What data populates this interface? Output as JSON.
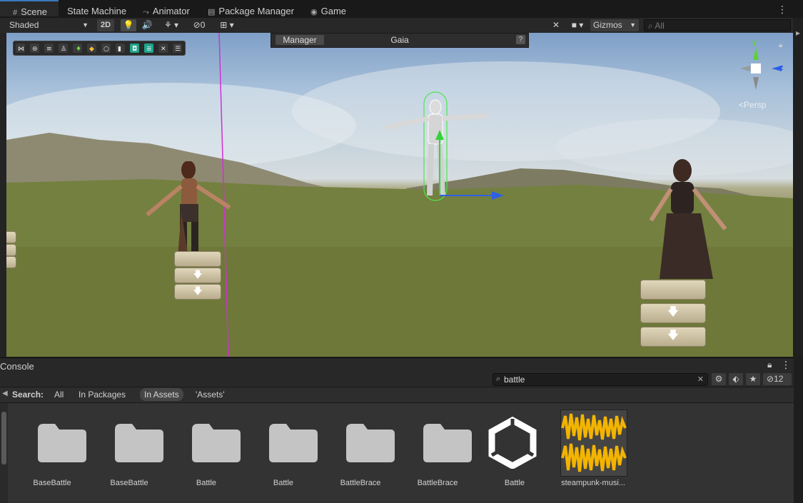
{
  "tabs": [
    {
      "label": "Scene",
      "icon": "grid-icon"
    },
    {
      "label": "State Machine",
      "icon": ""
    },
    {
      "label": "Animator",
      "icon": "animator-icon"
    },
    {
      "label": "Package Manager",
      "icon": "package-icon"
    },
    {
      "label": "Game",
      "icon": "gamepad-icon"
    }
  ],
  "toolbar": {
    "shading_mode": "Shaded",
    "mode_2d": "2D",
    "hidden_count": "0",
    "gizmos_label": "Gizmos",
    "search_placeholder": "All"
  },
  "overlay": {
    "manager_button": "Manager",
    "title": "Gaia",
    "help": "?"
  },
  "scene_gizmo": {
    "y": "y",
    "z": "z",
    "persp": "Persp"
  },
  "console": {
    "title": "Console",
    "search_value": "battle",
    "hidden_count": "12"
  },
  "filter": {
    "label": "Search:",
    "options": [
      "All",
      "In Packages",
      "In Assets",
      "'Assets'"
    ],
    "selected": "In Assets"
  },
  "assets": [
    {
      "name": "BaseBattle",
      "type": "folder"
    },
    {
      "name": "BaseBattle",
      "type": "folder"
    },
    {
      "name": "Battle",
      "type": "folder"
    },
    {
      "name": "Battle",
      "type": "folder"
    },
    {
      "name": "BattleBrace",
      "type": "folder"
    },
    {
      "name": "BattleBrace",
      "type": "folder"
    },
    {
      "name": "Battle",
      "type": "unity-scene"
    },
    {
      "name": "steampunk-musi...",
      "type": "audio"
    }
  ],
  "colors": {
    "accent": "#3a79bb",
    "audio_wave": "#f3b400",
    "gizmo_y": "#5fd03a",
    "gizmo_z": "#2f5fe6"
  }
}
